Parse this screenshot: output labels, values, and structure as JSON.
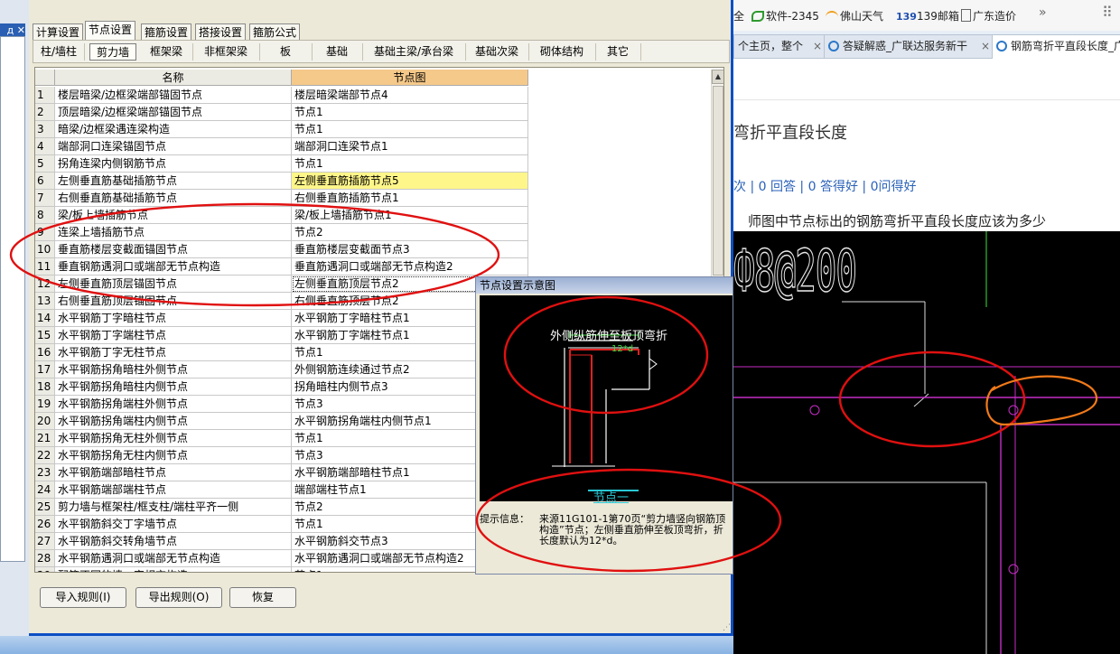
{
  "desktop": {
    "left_title_fragment": "д"
  },
  "browser": {
    "bookmarks": [
      "软件-2345",
      "佛山天气",
      "139邮箱",
      "广东造价"
    ],
    "more_chevron": "»",
    "tabs": [
      {
        "label": "个主页，整个",
        "close": "×"
      },
      {
        "label": "答疑解惑_广联达服务新干",
        "close": "×"
      },
      {
        "label": "钢筋弯折平直段长度_广",
        "close": ""
      }
    ],
    "question_title": "弯折平直段长度",
    "question_stats": "次 | 0 回答 | 0 答得好 | 0问得好",
    "question_desc": "师图中节点标出的钢筋弯折平直段长度应该为多少",
    "cad_text": "Ф8@200"
  },
  "dialog": {
    "top_tabs": [
      "计算设置",
      "节点设置",
      "箍筋设置",
      "搭接设置",
      "箍筋公式"
    ],
    "active_top_tab": "节点设置",
    "sub_tabs": [
      "柱/墙柱",
      "剪力墙",
      "框架梁",
      "非框架梁",
      "板",
      "基础",
      "基础主梁/承台梁",
      "基础次梁",
      "砌体结构",
      "其它"
    ],
    "active_sub_tab": "剪力墙",
    "columns": {
      "name": "名称",
      "diagram": "节点图"
    },
    "rows": [
      {
        "n": "1",
        "name": "楼层暗梁/边框梁端部锚固节点",
        "node": "楼层暗梁端部节点4"
      },
      {
        "n": "2",
        "name": "顶层暗梁/边框梁端部锚固节点",
        "node": "节点1"
      },
      {
        "n": "3",
        "name": "暗梁/边框梁遇连梁构造",
        "node": "节点1"
      },
      {
        "n": "4",
        "name": "端部洞口连梁锚固节点",
        "node": "端部洞口连梁节点1"
      },
      {
        "n": "5",
        "name": "拐角连梁内侧钢筋节点",
        "node": "节点1"
      },
      {
        "n": "6",
        "name": "左侧垂直筋基础插筋节点",
        "node": "左侧垂直筋插筋节点5"
      },
      {
        "n": "7",
        "name": "右侧垂直筋基础插筋节点",
        "node": "右侧垂直筋插筋节点1"
      },
      {
        "n": "8",
        "name": "梁/板上墙插筋节点",
        "node": "梁/板上墙插筋节点1"
      },
      {
        "n": "9",
        "name": "连梁上墙插筋节点",
        "node": "节点2"
      },
      {
        "n": "10",
        "name": "垂直筋楼层变截面锚固节点",
        "node": "垂直筋楼层变截面节点3"
      },
      {
        "n": "11",
        "name": "垂直钢筋遇洞口或端部无节点构造",
        "node": "垂直筋遇洞口或端部无节点构造2"
      },
      {
        "n": "12",
        "name": "左侧垂直筋顶层锚固节点",
        "node": "左侧垂直筋顶层节点2"
      },
      {
        "n": "13",
        "name": "右侧垂直筋顶层锚固节点",
        "node": "右侧垂直筋顶层节点2"
      },
      {
        "n": "14",
        "name": "水平钢筋丁字暗柱节点",
        "node": "水平钢筋丁字暗柱节点1"
      },
      {
        "n": "15",
        "name": "水平钢筋丁字端柱节点",
        "node": "水平钢筋丁字端柱节点1"
      },
      {
        "n": "16",
        "name": "水平钢筋丁字无柱节点",
        "node": "节点1"
      },
      {
        "n": "17",
        "name": "水平钢筋拐角暗柱外侧节点",
        "node": "外侧钢筋连续通过节点2"
      },
      {
        "n": "18",
        "name": "水平钢筋拐角暗柱内侧节点",
        "node": "拐角暗柱内侧节点3"
      },
      {
        "n": "19",
        "name": "水平钢筋拐角端柱外侧节点",
        "node": "节点3"
      },
      {
        "n": "20",
        "name": "水平钢筋拐角端柱内侧节点",
        "node": "水平钢筋拐角端柱内侧节点1"
      },
      {
        "n": "21",
        "name": "水平钢筋拐角无柱外侧节点",
        "node": "节点1"
      },
      {
        "n": "22",
        "name": "水平钢筋拐角无柱内侧节点",
        "node": "节点3"
      },
      {
        "n": "23",
        "name": "水平钢筋端部暗柱节点",
        "node": "水平钢筋端部暗柱节点1"
      },
      {
        "n": "24",
        "name": "水平钢筋端部端柱节点",
        "node": "端部端柱节点1"
      },
      {
        "n": "25",
        "name": "剪力墙与框架柱/框支柱/端柱平齐一侧",
        "node": "节点2"
      },
      {
        "n": "26",
        "name": "水平钢筋斜交丁字墙节点",
        "node": "节点1"
      },
      {
        "n": "27",
        "name": "水平钢筋斜交转角墙节点",
        "node": "水平钢筋斜交节点3"
      },
      {
        "n": "28",
        "name": "水平钢筋遇洞口或端部无节点构造",
        "node": "水平钢筋遇洞口或端部无节点构造2"
      },
      {
        "n": "29",
        "name": "配筋不同的墙一字相交构造",
        "node": "节点1"
      }
    ],
    "highlight_row": "6",
    "selected_row": "12",
    "buttons": {
      "import": "导入规则(I)",
      "export": "导出规则(O)",
      "restore": "恢复"
    },
    "colors": {
      "highlight": "#fff68a",
      "selected": "#fff68a",
      "header_diagram": "#f5c98a",
      "annotation": "#e01010"
    }
  },
  "popup": {
    "title": "节点设置示意图",
    "diagram_heading": "外侧纵筋伸至板顶弯折",
    "dimension": "12*d",
    "caption": "节点一",
    "hint_label": "提示信息：",
    "hint_text": "来源11G101-1第70页“剪力墙竖向钢筋顶构造”节点；左侧垂直筋伸至板顶弯折，折长度默认为12*d。"
  }
}
